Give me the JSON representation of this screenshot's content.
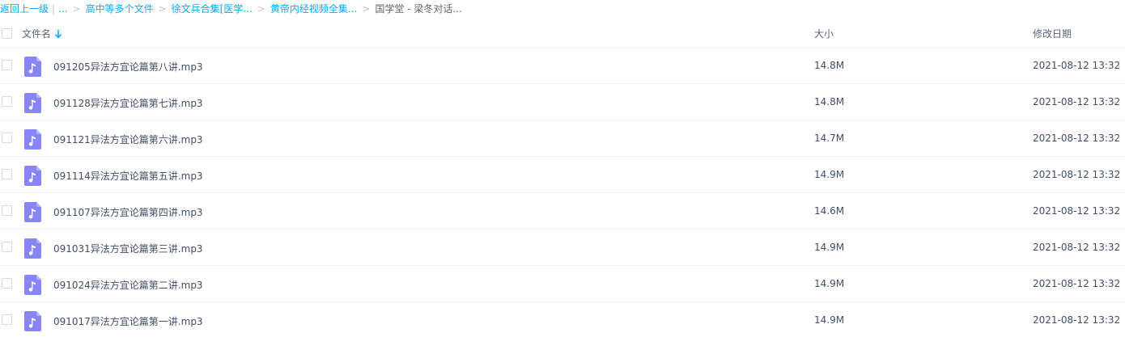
{
  "breadcrumb": {
    "back_label": "返回上一级",
    "bar": "|",
    "ellipsis": "...",
    "sep": ">",
    "items": [
      {
        "label": "高中等多个文件"
      },
      {
        "label": "徐文兵合集[医学..."
      },
      {
        "label": "黄帝内经视频全集..."
      }
    ],
    "current": "国学堂 - 梁冬对话..."
  },
  "header": {
    "name": "文件名",
    "size": "大小",
    "date": "修改日期",
    "sort_icon": "arrow-down-icon"
  },
  "colors": {
    "link": "#09aaff",
    "icon_bg": "#8785f7",
    "text": "#424e67"
  },
  "files": [
    {
      "name": "091205异法方宜论篇第八讲.mp3",
      "size": "14.8M",
      "date": "2021-08-12 13:32",
      "icon": "music-file-icon"
    },
    {
      "name": "091128异法方宜论篇第七讲.mp3",
      "size": "14.8M",
      "date": "2021-08-12 13:32",
      "icon": "music-file-icon"
    },
    {
      "name": "091121异法方宜论篇第六讲.mp3",
      "size": "14.7M",
      "date": "2021-08-12 13:32",
      "icon": "music-file-icon"
    },
    {
      "name": "091114异法方宜论篇第五讲.mp3",
      "size": "14.9M",
      "date": "2021-08-12 13:32",
      "icon": "music-file-icon"
    },
    {
      "name": "091107异法方宜论篇第四讲.mp3",
      "size": "14.6M",
      "date": "2021-08-12 13:32",
      "icon": "music-file-icon"
    },
    {
      "name": "091031异法方宜论篇第三讲.mp3",
      "size": "14.9M",
      "date": "2021-08-12 13:32",
      "icon": "music-file-icon"
    },
    {
      "name": "091024异法方宜论篇第二讲.mp3",
      "size": "14.9M",
      "date": "2021-08-12 13:32",
      "icon": "music-file-icon"
    },
    {
      "name": "091017异法方宜论篇第一讲.mp3",
      "size": "14.9M",
      "date": "2021-08-12 13:32",
      "icon": "music-file-icon"
    }
  ]
}
